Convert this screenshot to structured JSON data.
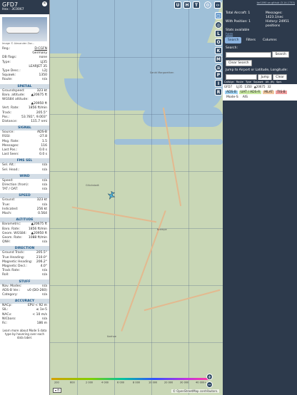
{
  "aircraft": {
    "callsign": "GFD7",
    "hex_line": "Hex : 3C0067",
    "image_credit": "Image © Alexander Zaz..."
  },
  "info_rows": [
    {
      "k": "Reg.:",
      "v": "D-CGFN",
      "link": true
    },
    {
      "k": "",
      "v": "Germany"
    },
    {
      "k": "DB flags:",
      "v": "none"
    },
    {
      "k": "Type:",
      "v": "LJ35"
    },
    {
      "k": "",
      "v": "LEARJET 35"
    },
    {
      "k": "Type Desc.:",
      "v": "L2J"
    },
    {
      "k": "Squawk:",
      "v": "1350"
    },
    {
      "k": "Route:",
      "v": "n/a"
    }
  ],
  "sections": [
    {
      "title": "SPATIAL",
      "rows": [
        {
          "k": "Groundspeed:",
          "v": "323 kt"
        },
        {
          "k": "Baro. altitude:",
          "v": "▲20675 ft"
        },
        {
          "k": "WGS84 altitude:",
          "v": ""
        },
        {
          "k": "",
          "v": "▲20950 ft"
        },
        {
          "k": "Vert. Rate:",
          "v": "1856 ft/min"
        },
        {
          "k": "Track:",
          "v": "205.5°"
        },
        {
          "k": "Pos.:",
          "v": "53.781°, 9.003°"
        },
        {
          "k": "Distance:",
          "v": "115.7 nmi"
        }
      ]
    },
    {
      "title": "SIGNAL",
      "rows": [
        {
          "k": "Source:",
          "v": "ADS-B"
        },
        {
          "k": "RSSI:",
          "v": "-27.8"
        },
        {
          "k": "Msg. Rate:",
          "v": "1.5"
        },
        {
          "k": "Messages:",
          "v": "116"
        },
        {
          "k": "Last Pos.:",
          "v": "0.0 s"
        },
        {
          "k": "Last Seen:",
          "v": "0.0 s"
        }
      ]
    },
    {
      "title": "FMS SEL",
      "rows": [
        {
          "k": "Sel. Alt.:",
          "v": "n/a"
        },
        {
          "k": "Sel. Head.:",
          "v": "n/a"
        }
      ]
    },
    {
      "title": "WIND",
      "rows": [
        {
          "k": "Speed:",
          "v": "n/a"
        },
        {
          "k": "Direction (from):",
          "v": "n/a"
        },
        {
          "k": "TAT / OAT:",
          "v": "n/a"
        }
      ]
    },
    {
      "title": "SPEED",
      "rows": [
        {
          "k": "Ground:",
          "v": "323 kt"
        },
        {
          "k": "True:",
          "v": "n/a"
        },
        {
          "k": "Indicated:",
          "v": "256 kt"
        },
        {
          "k": "Mach:",
          "v": "0.564"
        }
      ]
    },
    {
      "title": "ALTITUDE",
      "rows": [
        {
          "k": "Barometric:",
          "v": "▲20675 ft"
        },
        {
          "k": "Baro. Rate:",
          "v": "1856 ft/min"
        },
        {
          "k": "Geom. WGS84:",
          "v": "▲20950 ft"
        },
        {
          "k": "Geom. Rate:",
          "v": "1088 ft/min"
        },
        {
          "k": "QNH:",
          "v": "n/a"
        }
      ]
    },
    {
      "title": "DIRECTION",
      "rows": [
        {
          "k": "Ground Track:",
          "v": "205.5°"
        },
        {
          "k": "True Heading:",
          "v": "210.0°"
        },
        {
          "k": "Magnetic Heading:",
          "v": "206.2°"
        },
        {
          "k": "Magnetic Decl.:",
          "v": "4.0°"
        },
        {
          "k": "Track Rate:",
          "v": "n/a"
        },
        {
          "k": "Roll:",
          "v": "n/a"
        }
      ]
    },
    {
      "title": "STUFF",
      "rows": [
        {
          "k": "Nav. Modes:",
          "v": "n/a"
        },
        {
          "k": "ADS-B Ver.:",
          "v": "v0 (DO-260)"
        },
        {
          "k": "Category:",
          "v": "n/a"
        }
      ]
    },
    {
      "title": "ACCURACY",
      "rows": [
        {
          "k": "NACp:",
          "v": "EPU < 92 m"
        },
        {
          "k": "SIL:",
          "v": "≤ 1e-5"
        },
        {
          "k": "NACv:",
          "v": "< 10 m/s"
        },
        {
          "k": "NICbaro:",
          "v": "n/a"
        },
        {
          "k": "Rc:",
          "v": "186 m"
        }
      ]
    }
  ],
  "footer_note": "Learn more about Mode S data type by hovering over each data label.",
  "map_buttons": {
    "top": [
      "U",
      "H",
      "T"
    ],
    "side": [
      "L",
      "O",
      "K",
      "M",
      "P",
      "I",
      "R"
    ]
  },
  "right": {
    "version_link": "tar1090 on github (3.14.1733)",
    "total_label": "Total Aircraft: 1",
    "messages_label": "Messages: 1423.1/sec",
    "position_label": "With Position: 1",
    "history_label": "History: 24951 positions",
    "stats_label": "Stats available",
    "stats_link": "here",
    "tabs": [
      "Search",
      "Filters",
      "Columns"
    ],
    "search_label": "Search:",
    "search_btn": "Search",
    "clear_search": "Clear Search",
    "jump_label": "Jump to Airport or Latitude, Longitude:",
    "jump_btn": "Jump",
    "clear_btn": "Clear"
  },
  "table": {
    "headers": [
      "Callsign",
      "Route",
      "Type",
      "Squawk",
      "Alt. (ft)",
      "Spd."
    ],
    "rows": [
      [
        "GFD7",
        "",
        "LJ35",
        "1350",
        "▲20675",
        "32"
      ]
    ]
  },
  "legend": [
    "ADS-B",
    "UAT / ADS-R",
    "MLAT",
    "TIS-B",
    "Mode-S",
    "AIS"
  ],
  "scale_labels": [
    "200",
    "600",
    "2 000",
    "4 000",
    "6 000",
    "8 000",
    "10 000",
    "20 000",
    "30 000",
    "40 000+"
  ],
  "units_select": "ft",
  "attribution": "© OpenStreetMap contributors.",
  "places": [
    "Sankt Margarethen",
    "Glückstadt",
    "Krempe",
    "Itzehoe"
  ],
  "colors": {
    "panel": "#2d3a4c",
    "section": "#d3dde6",
    "accent": "#8bb3e0"
  }
}
